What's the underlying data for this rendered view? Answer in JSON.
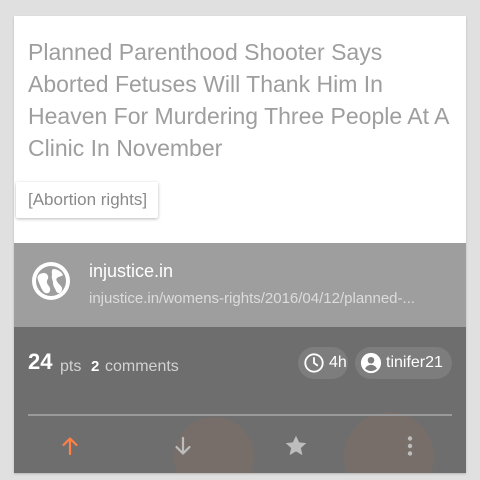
{
  "post": {
    "title": "Planned Parenthood Shooter Says Aborted Fetuses Will Thank Him In Heaven For Murdering Three People At A Clinic In November",
    "tag": "[Abortion rights]"
  },
  "source": {
    "icon": "globe-icon",
    "name": "injustice.in",
    "url": "injustice.in/womens-rights/2016/04/12/planned-..."
  },
  "meta": {
    "points": "24",
    "points_label": "pts",
    "comments": "2",
    "comments_label": "comments",
    "time": "4h",
    "user": "tinifer21"
  },
  "actions": [
    {
      "icon": "arrow-up-icon",
      "color": "#ff7f45"
    },
    {
      "icon": "arrow-down-icon",
      "color": "#bdbdbd"
    },
    {
      "icon": "star-icon",
      "color": "#bdbdbd"
    },
    {
      "icon": "more-vert-icon",
      "color": "#bdbdbd"
    }
  ],
  "colors": {
    "background": "#e0e0e0",
    "source_bar": "#9e9e9e",
    "meta_bar": "#6e6e6e",
    "upvote_accent": "#ff7f45"
  }
}
